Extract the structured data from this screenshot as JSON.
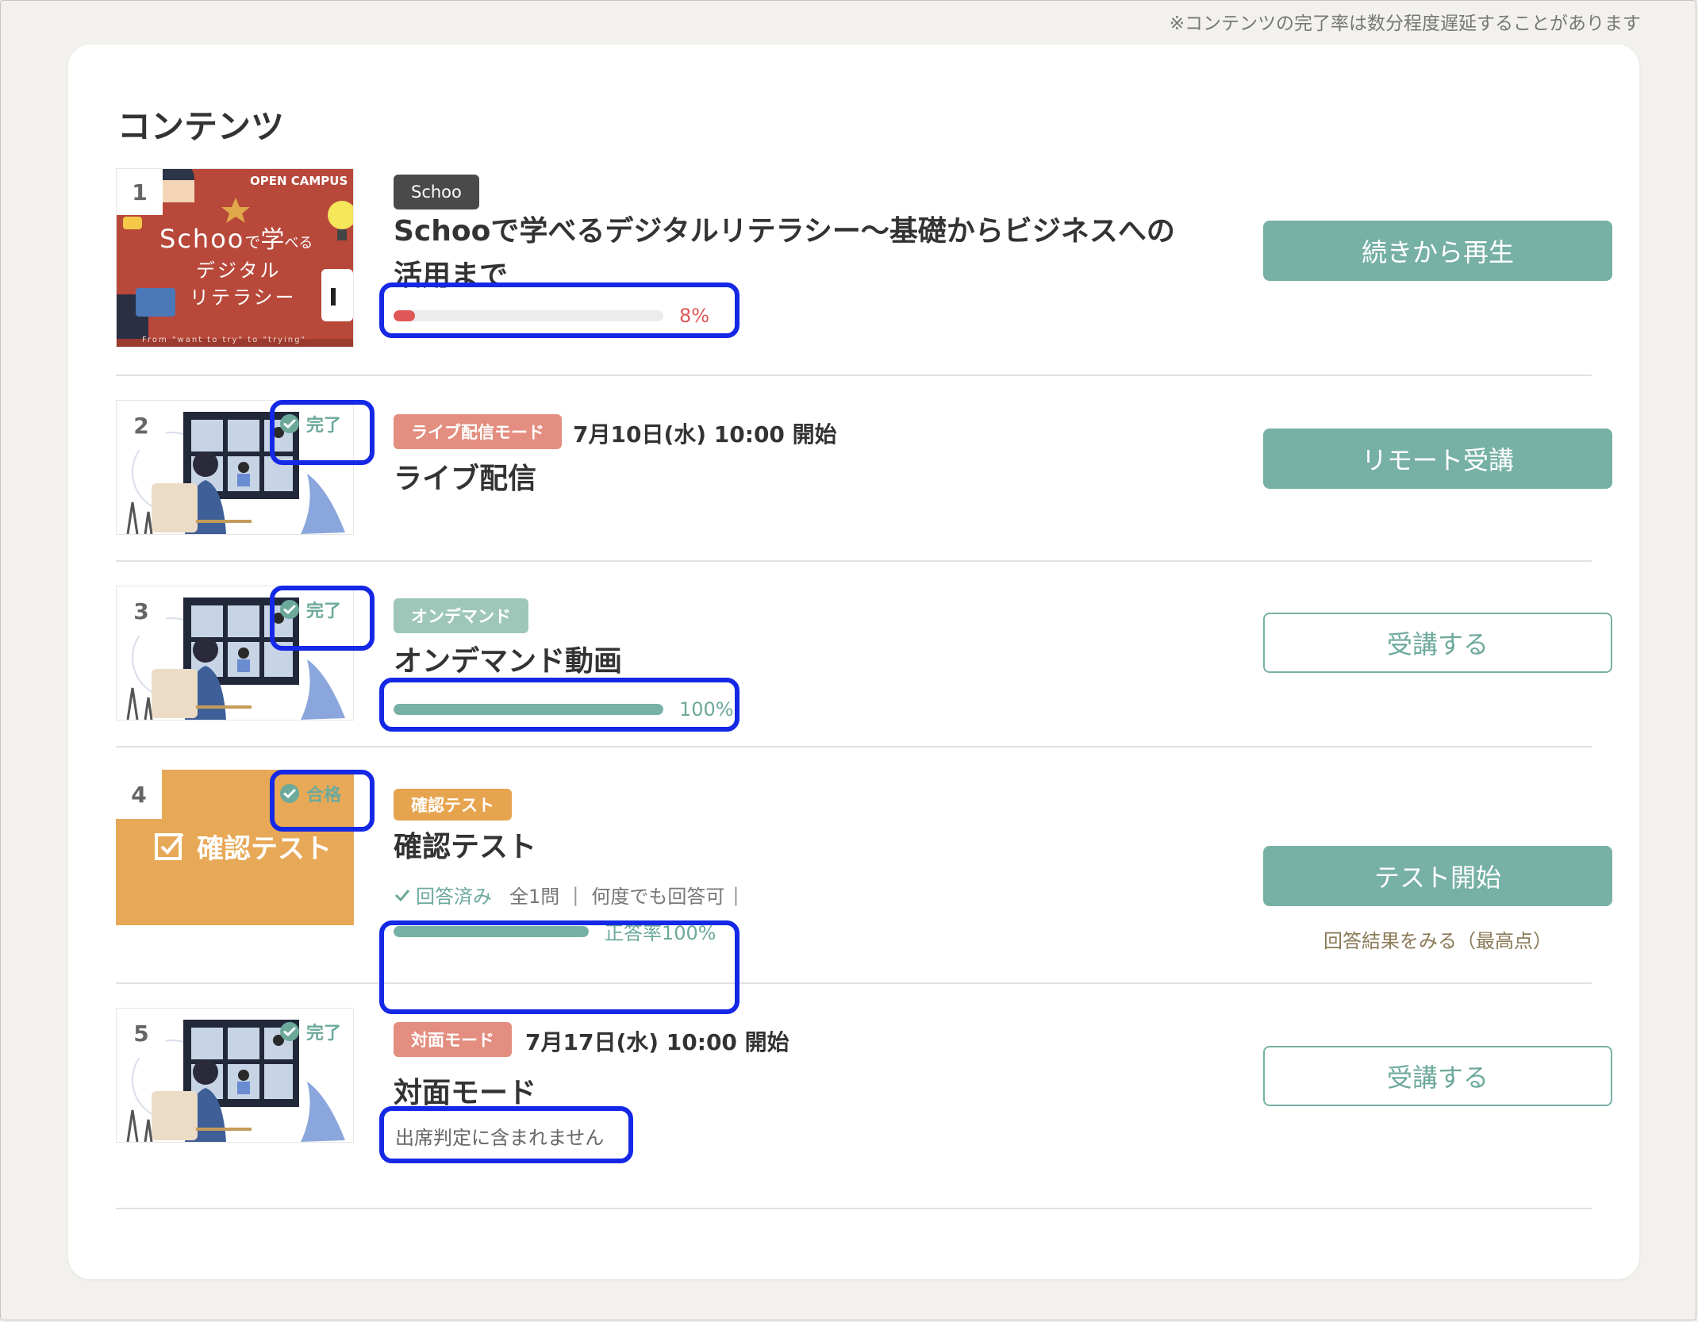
{
  "note": "※コンテンツの完了率は数分程度遅延することがあります",
  "section_title": "コンテンツ",
  "colors": {
    "accent": "#77b0a5",
    "highlight": "#1428e6",
    "progress_low": "#e05757"
  },
  "items": [
    {
      "num": "1",
      "tag": "Schoo",
      "title_line1": "Schooで学べるデジタルリテラシー〜基礎からビジネスへの",
      "title_line2": "活用まで",
      "thumb": {
        "brand": "OPEN CAMPUS",
        "line1": "Schoo",
        "line1b": "で",
        "line1c": "学",
        "line1d": "べる",
        "line2": "デジタル",
        "line3": "リテラシー",
        "footer": "From \"want to try\" to \"trying\""
      },
      "progress": 0.08,
      "progress_label": "8%",
      "button": "続きから再生"
    },
    {
      "num": "2",
      "status": "完了",
      "tag": "ライブ配信モード",
      "datetime": "7月10日(水) 10:00 開始",
      "title": "ライブ配信",
      "button": "リモート受講"
    },
    {
      "num": "3",
      "status": "完了",
      "tag": "オンデマンド",
      "title": "オンデマンド動画",
      "progress": 1.0,
      "progress_label": "100%",
      "button": "受講する"
    },
    {
      "num": "4",
      "status": "合格",
      "thumb_text": "確認テスト",
      "tag": "確認テスト",
      "title": "確認テスト",
      "answered": "回答済み",
      "question_count": "全1問",
      "retry": "何度でも回答可",
      "score": 1.0,
      "score_label": "正答率100%",
      "button": "テスト開始",
      "results_link": "回答結果をみる（最高点）"
    },
    {
      "num": "5",
      "status": "完了",
      "tag": "対面モード",
      "datetime": "7月17日(水) 10:00 開始",
      "title": "対面モード",
      "note": "出席判定に含まれません",
      "button": "受講する"
    }
  ]
}
